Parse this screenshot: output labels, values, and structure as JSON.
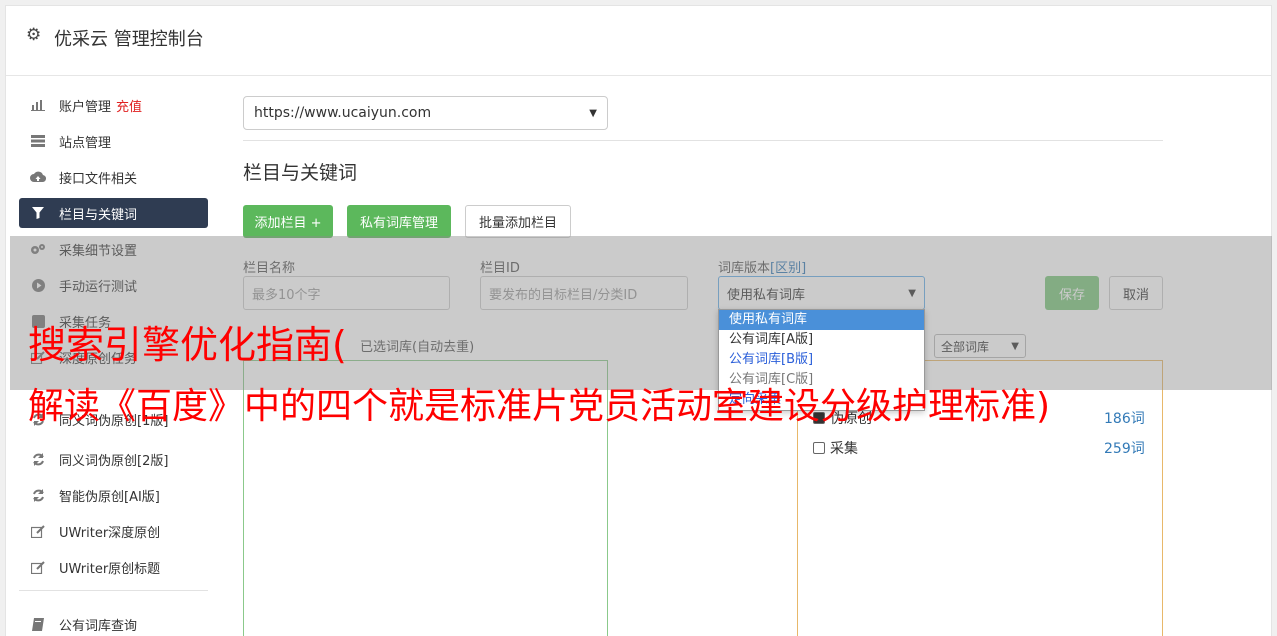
{
  "header": {
    "title": "优采云 管理控制台",
    "icon": "gear-icon"
  },
  "sidebar": {
    "items": [
      {
        "label": "账户管理",
        "badge": "充值",
        "icon": "bar-chart-icon"
      },
      {
        "label": "站点管理",
        "icon": "server-icon"
      },
      {
        "label": "接口文件相关",
        "icon": "cloud-upload-icon"
      },
      {
        "label": "栏目与关键词",
        "icon": "filter-icon",
        "active": true
      },
      {
        "label": "采集细节设置",
        "icon": "gears-icon"
      },
      {
        "label": "手动运行测试",
        "icon": "play-icon"
      },
      {
        "label": "采集任务",
        "icon": "task-icon"
      },
      {
        "label": "深度原创任务",
        "icon": "edit-icon"
      },
      {
        "label": "同义词伪原创[1版]",
        "icon": "refresh-icon"
      },
      {
        "label": "同义词伪原创[2版]",
        "icon": "refresh-icon"
      },
      {
        "label": "智能伪原创[AI版]",
        "icon": "refresh-icon"
      },
      {
        "label": "UWriter深度原创",
        "icon": "edit-icon"
      },
      {
        "label": "UWriter原创标题",
        "icon": "edit-icon"
      },
      {
        "label": "公有词库查询",
        "icon": "book-icon"
      }
    ]
  },
  "main": {
    "site_select": {
      "value": "https://www.ucaiyun.com"
    },
    "section_title": "栏目与关键词",
    "buttons": {
      "add_column": "添加栏目 +",
      "private_lib": "私有词库管理",
      "batch_add": "批量添加栏目"
    },
    "form": {
      "name_label": "栏目名称",
      "name_placeholder": "最多10个字",
      "id_label": "栏目ID",
      "id_placeholder": "要发布的目标栏目/分类ID",
      "lib_label": "词库版本",
      "lib_label_link": "[区别]",
      "lib_value": "使用私有词库",
      "save": "保存",
      "cancel": "取消"
    },
    "dropdown_options": [
      "使用私有词库",
      "公有词库[A版]",
      "公有词库[B版]",
      "公有词库[C版]",
      "定向采集"
    ],
    "selected_lib_label": "已选词库(自动去重)",
    "all_lib_select": "全部词库",
    "right_list": [
      {
        "label": "伪原创",
        "count": "186词",
        "checked": true
      },
      {
        "label": "采集",
        "count": "259词",
        "checked": false
      }
    ]
  },
  "banner": {
    "line1": "搜索引擎优化指南(",
    "line2": "解读《百度》中的四个就是标准片党员活动室建设分级护理标准)"
  },
  "colors": {
    "green": "#5cb85c",
    "active_nav": "#2f3c52",
    "banner_red": "#ff0000",
    "link_blue": "#337ab7"
  }
}
